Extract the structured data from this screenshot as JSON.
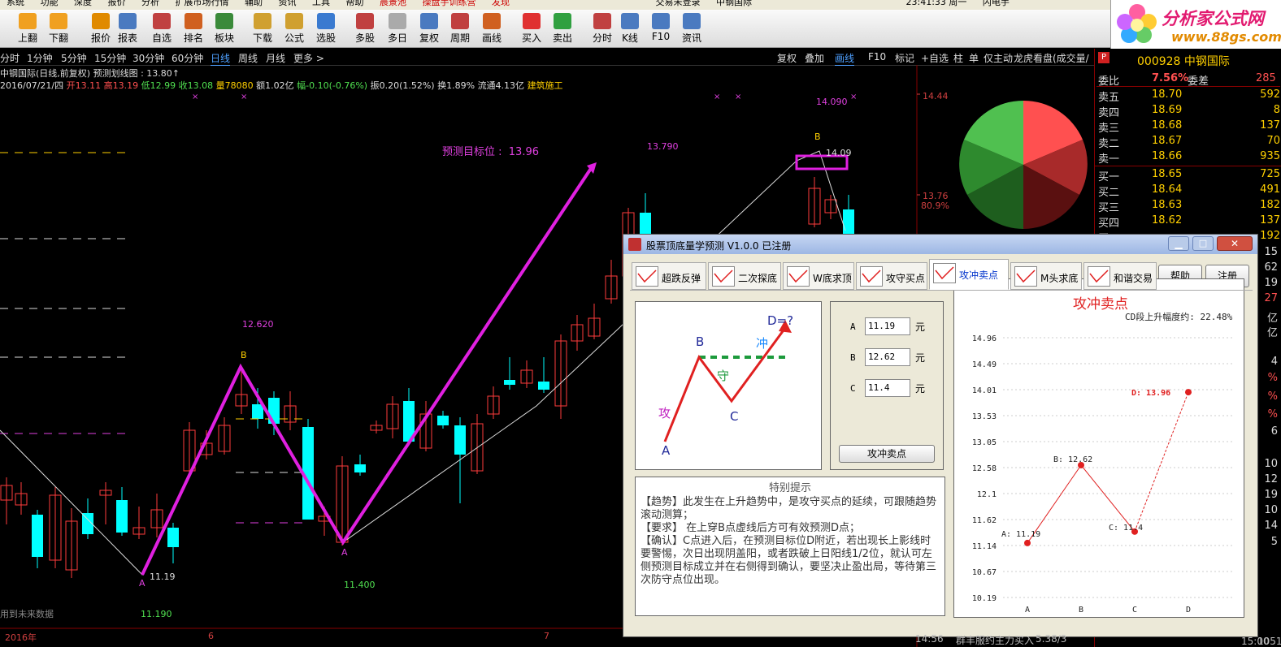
{
  "menu": [
    "系统",
    "功能",
    "深度",
    "报价",
    "分析",
    "扩展市场行情",
    "辅助",
    "资讯",
    "工具",
    "帮助",
    "晨景池",
    "操盘手训练营",
    "发现",
    "交易未登录",
    "中钢国际",
    "23:41:33 周一",
    "闪电手"
  ],
  "toolbar": [
    {
      "label": "上翻",
      "icon": "page-up-icon",
      "color": "#f0a020"
    },
    {
      "label": "下翻",
      "icon": "page-down-icon",
      "color": "#f0a020"
    },
    {
      "label": "报价",
      "icon": "yen-icon",
      "color": "#e08a00"
    },
    {
      "label": "报表",
      "icon": "report-icon",
      "color": "#4a7ac0"
    },
    {
      "label": "自选",
      "icon": "f6-icon",
      "color": "#c04040"
    },
    {
      "label": "排名",
      "icon": "ranking-icon",
      "color": "#d06020"
    },
    {
      "label": "板块",
      "icon": "sector-icon",
      "color": "#3a8a3a"
    },
    {
      "label": "下载",
      "icon": "download-icon",
      "color": "#d0a030"
    },
    {
      "label": "公式",
      "icon": "formula-icon",
      "color": "#d0a030"
    },
    {
      "label": "选股",
      "icon": "stock-pick-icon",
      "color": "#3a7ad0"
    },
    {
      "label": "多股",
      "icon": "multi-stock-icon",
      "color": "#c04040"
    },
    {
      "label": "多日",
      "icon": "multi-day-icon",
      "color": "#aaaaaa"
    },
    {
      "label": "复权",
      "icon": "restore-icon",
      "color": "#4a7ac0"
    },
    {
      "label": "周期",
      "icon": "f8-icon",
      "color": "#c04040"
    },
    {
      "label": "画线",
      "icon": "draw-line-icon",
      "color": "#d06020"
    },
    {
      "label": "买入",
      "icon": "buy-icon",
      "color": "#e03030"
    },
    {
      "label": "卖出",
      "icon": "sell-icon",
      "color": "#30a040"
    },
    {
      "label": "分时",
      "icon": "intraday-icon",
      "color": "#c04040"
    },
    {
      "label": "K线",
      "icon": "kline-icon",
      "color": "#4a7ac0"
    },
    {
      "label": "F10",
      "icon": "f10-icon",
      "color": "#4a7ac0"
    },
    {
      "label": "资讯",
      "icon": "news-icon",
      "color": "#4a7ac0"
    }
  ],
  "logo": {
    "title": "分析家公式网",
    "url": "www.88gs.com"
  },
  "periods": [
    "分时",
    "1分钟",
    "5分钟",
    "15分钟",
    "30分钟",
    "60分钟",
    "日线",
    "周线",
    "月线",
    "更多 >"
  ],
  "active_period": "日线",
  "chart_controls": [
    "复权",
    "叠加",
    "画线",
    "F10",
    "标记",
    "+自选",
    "柱",
    "单",
    "仅主动",
    "龙虎看盘(成交量/",
    "◇"
  ],
  "chart_header": "中钢国际(日线,前复权) 预测划线图 : 13.80↑",
  "quote": {
    "date": "2016/07/21/四",
    "open": "开13.11",
    "high": "高13.19",
    "low": "低12.99",
    "close": "收13.08",
    "volume": "量78080",
    "amount": "额1.02亿",
    "change": "幅-0.10(-0.76%)",
    "amplitude": "振0.20(1.52%)",
    "turnover": "换1.89%",
    "float": "流通4.13亿",
    "sector": "建筑施工"
  },
  "chart_labels": {
    "target": "预测目标位 :  13.96",
    "v13790": "13.790",
    "v12620": "12.620",
    "v14090": "14.090",
    "b_left": "B",
    "b_right": "B",
    "a_left": "A",
    "a_mid": "A",
    "v11190_a": "11.19",
    "v11190": "11.190",
    "v11400": "11.400",
    "v1409": "14.09",
    "footer": "用到未来数据",
    "axis": [
      "14.44",
      "13.76",
      "80.9%"
    ],
    "date_axis": [
      "2016年",
      "6",
      "7"
    ]
  },
  "side": {
    "code": "000928 中钢国际",
    "committee": {
      "label": "委比",
      "value": "7.56%",
      "label2": "委差",
      "diff": "285"
    },
    "asks": [
      {
        "label": "卖五",
        "price": "18.70",
        "vol": "592"
      },
      {
        "label": "卖四",
        "price": "18.69",
        "vol": "8"
      },
      {
        "label": "卖三",
        "price": "18.68",
        "vol": "137"
      },
      {
        "label": "卖二",
        "price": "18.67",
        "vol": "70"
      },
      {
        "label": "卖一",
        "price": "18.66",
        "vol": "935"
      }
    ],
    "bids": [
      {
        "label": "买一",
        "price": "18.65",
        "vol": "725"
      },
      {
        "label": "买二",
        "price": "18.64",
        "vol": "491"
      },
      {
        "label": "买三",
        "price": "18.63",
        "vol": "182"
      },
      {
        "label": "买四",
        "price": "18.62",
        "vol": "137"
      },
      {
        "label": "买五",
        "price": "",
        "vol": "192"
      }
    ],
    "partial": [
      "15",
      "62",
      "19",
      "27",
      "亿",
      "亿",
      "4",
      "%",
      "%",
      "%",
      "6",
      "10",
      "12",
      "19",
      "10",
      "14",
      "5"
    ],
    "bottom": [
      "14:56",
      "群丰服约",
      "主力买入",
      "5.38/3",
      "15:00",
      "1051"
    ]
  },
  "dialog": {
    "title": "股票顶底量学预测 V1.0.0 已注册",
    "tabs": [
      "超跌反弹",
      "二次探底",
      "W底求顶",
      "攻守买点",
      "攻冲卖点",
      "M头求底",
      "和谐交易"
    ],
    "active_tab": "攻冲卖点",
    "help": "帮助",
    "register": "注册",
    "diagram": {
      "A": "A",
      "B": "B",
      "C": "C",
      "D": "D=?",
      "attack": "攻",
      "guard": "守",
      "charge": "冲"
    },
    "inputs": [
      {
        "label": "A",
        "value": "11.19",
        "unit": "元"
      },
      {
        "label": "B",
        "value": "12.62",
        "unit": "元"
      },
      {
        "label": "C",
        "value": "11.4",
        "unit": "元"
      }
    ],
    "calc_button": "攻冲卖点",
    "tips_title": "特别提示",
    "tips": "【趋势】此发生在上升趋势中，是攻守买点的延续，可跟随趋势滚动测算；\n【要求】 在上穿B点虚线后方可有效预测D点；\n【确认】C点进入后，在预测目标位D附近，若出现长上影线时要警惕，次日出现阴盖阳，或者跌破上日阳线1/2位，就认可左侧预测目标成立并在右侧得到确认，要坚决止盈出局，等待第三次防守点位出现。",
    "chart": {
      "title": "攻冲卖点",
      "cd_label": "CD段上升幅度约: 22.48%"
    }
  },
  "chart_data": {
    "type": "line",
    "title": "攻冲卖点",
    "categories": [
      "A",
      "B",
      "C",
      "D"
    ],
    "values": [
      11.19,
      12.62,
      11.4,
      13.96
    ],
    "point_labels": [
      "A: 11.19",
      "B: 12.62",
      "C: 11.4",
      "D: 13.96"
    ],
    "yticks": [
      "14.96",
      "14.49",
      "14.01",
      "13.53",
      "13.05",
      "12.58",
      "12.1",
      "11.62",
      "11.14",
      "10.67",
      "10.19"
    ],
    "ylim": [
      10.19,
      14.96
    ],
    "dashed_last_segment": true,
    "color": "#e02020",
    "grid": true
  }
}
